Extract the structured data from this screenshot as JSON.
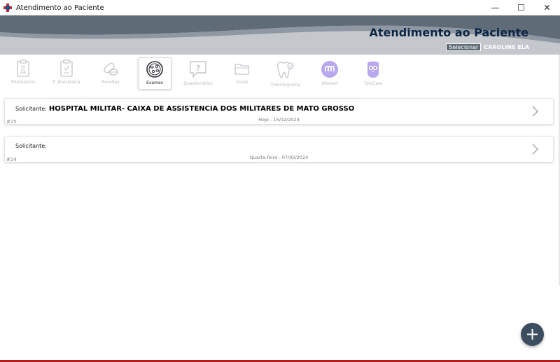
{
  "window": {
    "title": "Atendimento ao Paciente",
    "controls": {
      "minimize": "—",
      "maximize": "☐",
      "close": "✕"
    }
  },
  "header": {
    "title": "Atendimento ao Paciente",
    "select_label": "Selecionar",
    "user_name": "CAROLINE ELA",
    "title_color": "#0b2545",
    "wave_dark": "#5f6b77",
    "wave_light": "#c4c7cc"
  },
  "toolbar": {
    "items": [
      {
        "label": "Prontuários",
        "icon": "clipboard-icon",
        "active": false
      },
      {
        "label": "F. Anestésica",
        "icon": "clipboard-check-icon",
        "active": false
      },
      {
        "label": "Receitas",
        "icon": "pills-icon",
        "active": false
      },
      {
        "label": "Exames",
        "icon": "petri-dish-icon",
        "active": true
      },
      {
        "label": "Questionários",
        "icon": "question-bubble-icon",
        "active": false
      },
      {
        "label": "Guias",
        "icon": "folder-icon",
        "active": false
      },
      {
        "label": "Odontograma",
        "icon": "tooth-icon",
        "active": false
      },
      {
        "label": "Memed",
        "icon": "memed-icon",
        "active": false
      },
      {
        "label": "TytoCare",
        "icon": "tytocare-icon",
        "active": false
      }
    ]
  },
  "exams": [
    {
      "solicitante_label": "Solicitante:",
      "solicitante_name": "HOSPITAL MILITAR- CAIXA DE ASSISTENCIA DOS MILITARES DE MATO GROSSO",
      "id": "#25",
      "date": "Hoje - 15/02/2024"
    },
    {
      "solicitante_label": "Solicitante:",
      "solicitante_name": "",
      "id": "#24",
      "date": "Quarta-feira - 07/02/2024"
    }
  ],
  "fab": {
    "label": "+",
    "icon": "plus-icon"
  }
}
